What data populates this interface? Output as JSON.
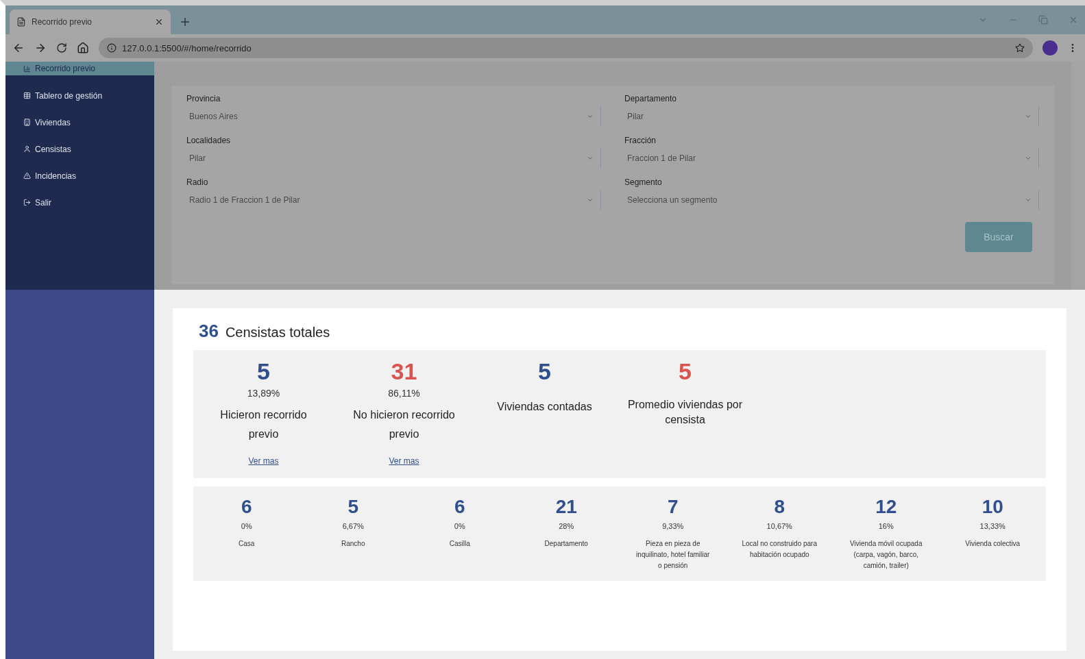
{
  "browser": {
    "tab_title": "Recorrido previo",
    "url": "127.0.0.1:5500/#/home/recorrido"
  },
  "sidebar": {
    "items": [
      {
        "label": "Recorrido previo",
        "selected": true
      },
      {
        "label": "Tablero de gestión",
        "selected": false
      },
      {
        "label": "Viviendas",
        "selected": false
      },
      {
        "label": "Censistas",
        "selected": false
      },
      {
        "label": "Incidencias",
        "selected": false
      },
      {
        "label": "Salir",
        "selected": false
      }
    ]
  },
  "filters": [
    {
      "label": "Provincia",
      "value": "Buenos Aires"
    },
    {
      "label": "Departamento",
      "value": "Pilar"
    },
    {
      "label": "Localidades",
      "value": "Pilar"
    },
    {
      "label": "Fracción",
      "value": "Fraccion 1 de Pilar"
    },
    {
      "label": "Radio",
      "value": "Radio 1 de Fraccion 1 de Pilar"
    },
    {
      "label": "Segmento",
      "placeholder": "Selecciona un segmento"
    }
  ],
  "search_button": "Buscar",
  "summary": {
    "total": "36",
    "total_label": "Censistas totales",
    "stats": [
      {
        "value": "5",
        "percent": "13,89%",
        "label": "Hicieron recorrido previo",
        "link": "Ver mas",
        "color": "#2f4f8f"
      },
      {
        "value": "31",
        "percent": "86,11%",
        "label": "No hicieron recorrido previo",
        "link": "Ver mas",
        "color": "#d9534f"
      },
      {
        "value": "5",
        "label": "Viviendas contadas",
        "color": "#2f4f8f"
      },
      {
        "value": "5",
        "label": "Promedio viviendas por censista",
        "color": "#d9534f"
      }
    ],
    "housing": [
      {
        "value": "6",
        "percent": "0%",
        "label": "Casa"
      },
      {
        "value": "5",
        "percent": "6,67%",
        "label": "Rancho"
      },
      {
        "value": "6",
        "percent": "0%",
        "label": "Casilla"
      },
      {
        "value": "21",
        "percent": "28%",
        "label": "Departamento"
      },
      {
        "value": "7",
        "percent": "9,33%",
        "label": "Pieza en pieza de inquilinato, hotel familiar o pensión"
      },
      {
        "value": "8",
        "percent": "10,67%",
        "label": "Local no construido para habitación ocupado"
      },
      {
        "value": "12",
        "percent": "16%",
        "label": "Vivienda móvil ocupada (carpa, vagón, barco, camión, trailer)"
      },
      {
        "value": "10",
        "percent": "13,33%",
        "label": "Vivienda colectiva"
      }
    ]
  }
}
